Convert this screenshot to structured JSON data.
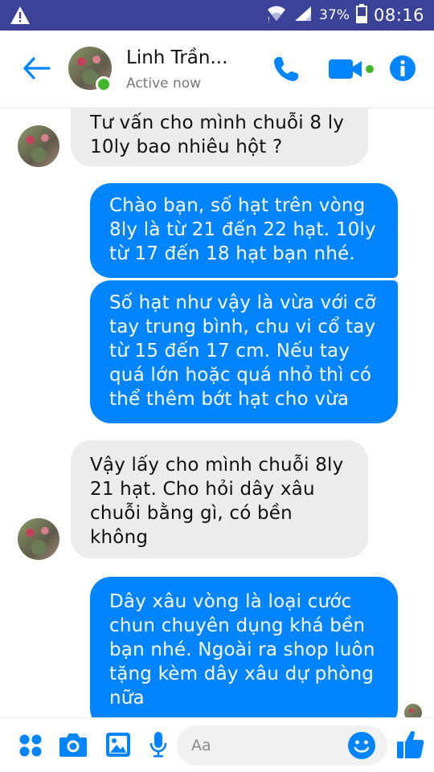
{
  "status_bar": {
    "battery_percent": "37%",
    "time": "08:16"
  },
  "header": {
    "contact_name": "Linh Trần...",
    "status": "Active now"
  },
  "messages": [
    {
      "side": "incoming",
      "text": "Tư vấn cho mình chuỗi 8 ly\n10ly bao nhiêu hột ?"
    },
    {
      "side": "outgoing",
      "text": "Chào bạn, số hạt trên vòng\n8ly là từ 21 đến 22 hạt. 10ly\ntừ 17 đến 18 hạt bạn nhé."
    },
    {
      "side": "outgoing",
      "text": "Số hạt như vậy là vừa với cỡ\ntay trung bình, chu vi cổ tay\ntừ 15 đến 17 cm. Nếu tay\nquá lớn hoặc quá nhỏ thì có\nthể thêm bớt hạt cho vừa"
    },
    {
      "side": "incoming",
      "text": "Vậy lấy cho mình chuỗi 8ly\n21 hạt. Cho hỏi dây xâu\nchuỗi bằng gì, có bền\nkhông"
    },
    {
      "side": "outgoing",
      "text": "Dây xâu vòng là loại cước\nchun chuyên dụng khá bền\nbạn nhé. Ngoài ra shop luôn\ntặng kèm dây xâu dự phòng\nnữa"
    }
  ],
  "composer": {
    "placeholder": "Aa"
  },
  "colors": {
    "status_bar": "#3b4399",
    "accent": "#0084ff",
    "incoming_bubble": "#ececec",
    "online": "#42b72a"
  }
}
